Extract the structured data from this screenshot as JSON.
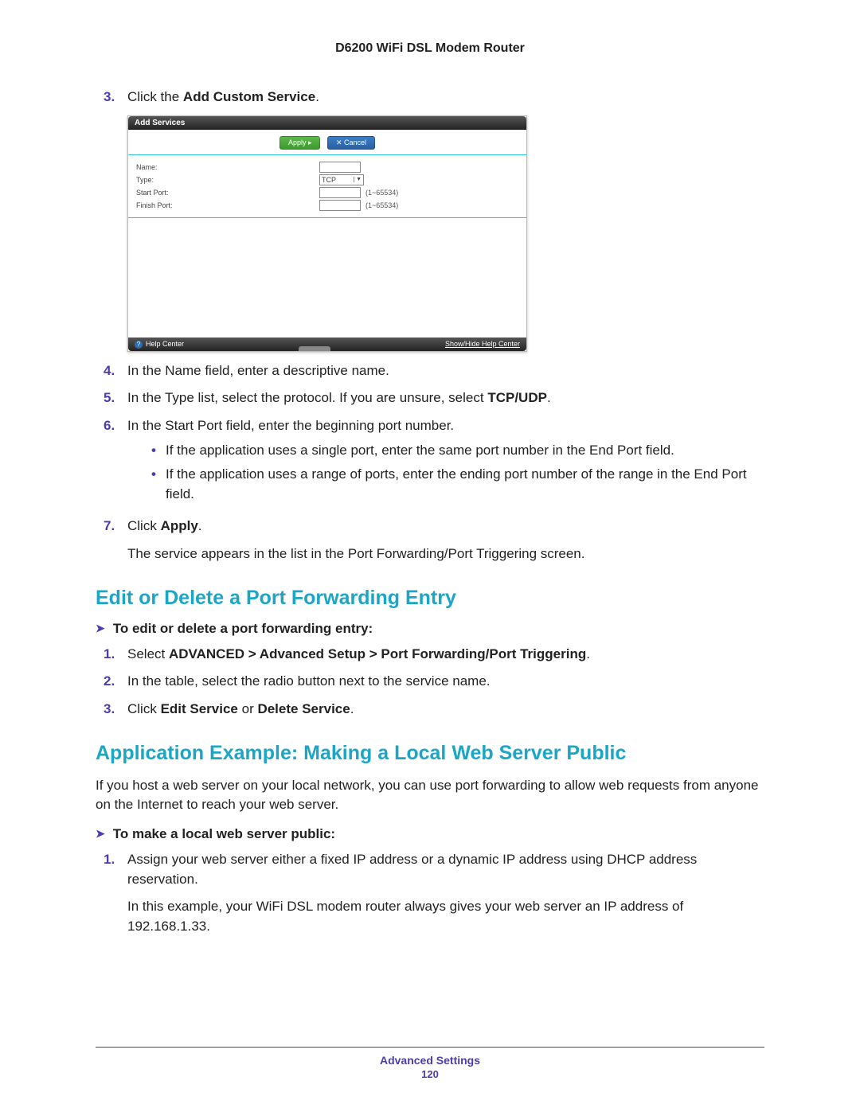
{
  "header": {
    "title": "D6200 WiFi DSL Modem Router"
  },
  "steps_a": {
    "s3": {
      "num": "3.",
      "pre": "Click the ",
      "bold": "Add Custom Service",
      "post": "."
    },
    "s4": {
      "num": "4.",
      "text": "In the Name field, enter a descriptive name."
    },
    "s5": {
      "num": "5.",
      "pre": "In the Type list, select the protocol. If you are unsure, select ",
      "bold": "TCP/UDP",
      "post": "."
    },
    "s6": {
      "num": "6.",
      "text": "In the Start Port field, enter the beginning port number.",
      "b1": "If the application uses a single port, enter the same port number in the End Port field.",
      "b2": "If the application uses a range of ports, enter the ending port number of the range in the End Port field."
    },
    "s7": {
      "num": "7.",
      "pre": "Click ",
      "bold": "Apply",
      "post": ".",
      "after": "The service appears in the list in the Port Forwarding/Port Triggering screen."
    }
  },
  "section1": {
    "title": "Edit or Delete a Port Forwarding Entry",
    "proc": "To edit or delete a port forwarding entry:",
    "s1": {
      "num": "1.",
      "pre": "Select ",
      "bold": "ADVANCED > Advanced Setup > Port Forwarding/Port Triggering",
      "post": "."
    },
    "s2": {
      "num": "2.",
      "text": "In the table, select the radio button next to the service name."
    },
    "s3": {
      "num": "3.",
      "pre": "Click ",
      "bold1": "Edit Service",
      "mid": " or ",
      "bold2": "Delete Service",
      "post": "."
    }
  },
  "section2": {
    "title": "Application Example: Making a Local Web Server Public",
    "intro": "If you host a web server on your local network, you can use port forwarding to allow web requests from anyone on the Internet to reach your web server.",
    "proc": "To make a local web server public:",
    "s1": {
      "num": "1.",
      "text": "Assign your web server either a fixed IP address or a dynamic IP address using DHCP address reservation.",
      "after": "In this example, your WiFi DSL modem router always gives your web server an IP address of 192.168.1.33."
    }
  },
  "ui": {
    "title": "Add Services",
    "apply": "Apply ▸",
    "cancel": "✕ Cancel",
    "name": "Name:",
    "type": "Type:",
    "type_val": "TCP",
    "start": "Start Port:",
    "finish": "Finish Port:",
    "hint": "(1~65534)",
    "help": "Help Center",
    "showhide": "Show/Hide Help Center"
  },
  "footer": {
    "section": "Advanced Settings",
    "page": "120"
  }
}
